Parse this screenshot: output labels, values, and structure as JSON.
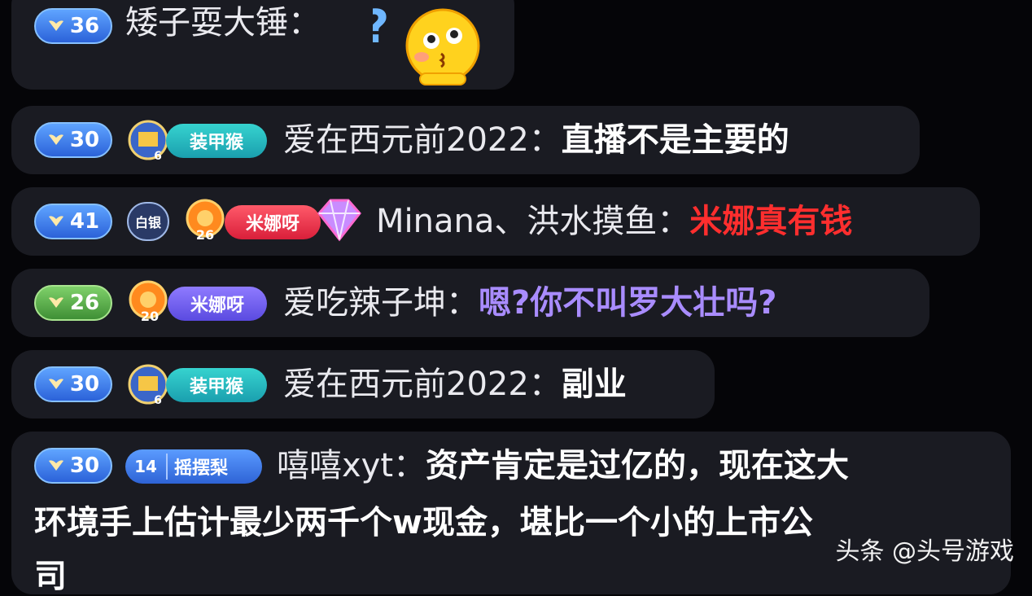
{
  "messages": [
    {
      "level": "36",
      "username": "矮子耍大锤",
      "colon": "：",
      "text": ""
    },
    {
      "level": "30",
      "badge_name": "装甲猴",
      "fan_level": "6",
      "username": "爱在西元前2022",
      "colon": "：",
      "text": "直播不是主要的"
    },
    {
      "level": "41",
      "rank_badge": "白银",
      "badge_name": "米娜呀",
      "fan_level": "26",
      "username": "Minana、洪水摸鱼",
      "colon": "：",
      "text": "米娜真有钱"
    },
    {
      "level": "26",
      "badge_name": "米娜呀",
      "fan_level": "20",
      "username": "爱吃辣子坤",
      "colon": "：",
      "text": "嗯?你不叫罗大壮吗?"
    },
    {
      "level": "30",
      "badge_name": "装甲猴",
      "fan_level": "6",
      "username": "爱在西元前2022",
      "colon": "：",
      "text": "副业"
    },
    {
      "level": "30",
      "badge_level": "14",
      "badge_name": "摇摆梨",
      "username": "嘻嘻xyt",
      "colon": "：",
      "text_line1": "资产肯定是过亿的，现在这大",
      "text_line2": "环境手上估计最少两千个w现金，堪比一个小的上市公",
      "text_line3": "司"
    }
  ],
  "watermark": "头条 @头号游戏",
  "colors": {
    "level_blue": "#2b62d9",
    "level_green": "#3f8f35",
    "highlight_red": "#ff2e2e",
    "highlight_violet": "#a98cff"
  }
}
